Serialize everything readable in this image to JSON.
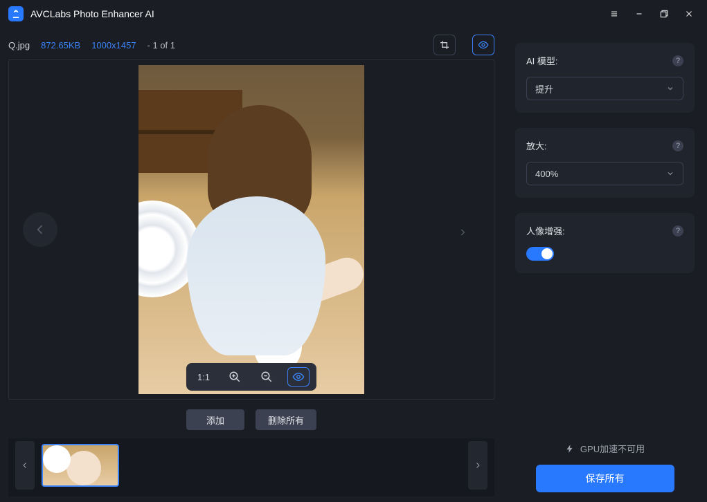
{
  "app": {
    "title": "AVCLabs Photo Enhancer AI"
  },
  "file": {
    "name": "Q.jpg",
    "size": "872.65KB",
    "resolution": "1000x1457",
    "counter": "- 1 of 1"
  },
  "viewer": {
    "ratio_label": "1:1"
  },
  "actions": {
    "add": "添加",
    "delete_all": "删除所有"
  },
  "panel_model": {
    "label": "AI 模型:",
    "value": "提升"
  },
  "panel_upscale": {
    "label": "放大:",
    "value": "400%"
  },
  "panel_face": {
    "label": "人像增强:",
    "toggle": true
  },
  "gpu_note": "GPU加速不可用",
  "save": "保存所有"
}
